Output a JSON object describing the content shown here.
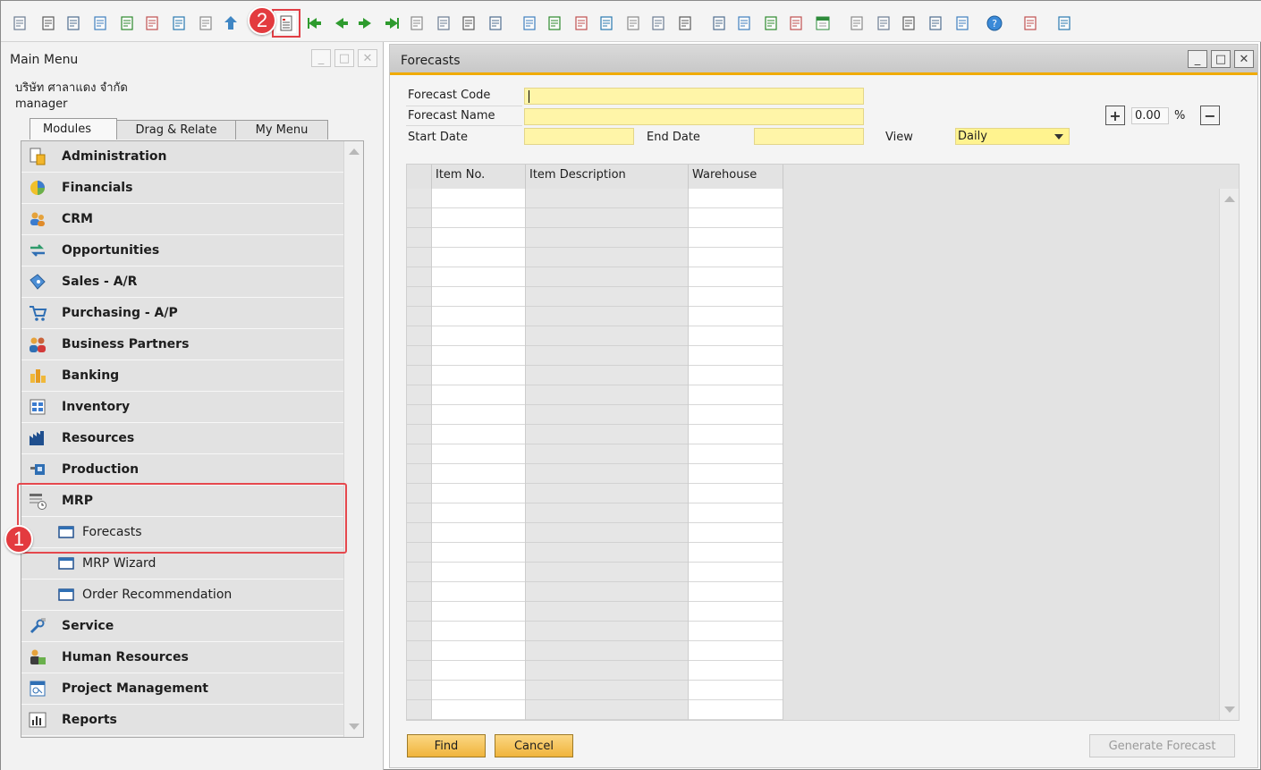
{
  "toolbar": {
    "icons": [
      "print-preview",
      "print",
      "email",
      "sms",
      "export-excel",
      "export-excel-alt",
      "export-word",
      "export-pdf",
      "launch-app",
      "lock-screen",
      "form-settings",
      "first-record",
      "previous-record",
      "next-record",
      "last-record",
      "refresh",
      "filter",
      "sort",
      "base-document",
      "target-document",
      "document-journal",
      "gross-profit",
      "cost-accounting",
      "financial-report",
      "query",
      "edit",
      "create-document",
      "settings",
      "message",
      "message-alt",
      "calendar",
      "mail-alert",
      "spreadsheet",
      "organization",
      "user",
      "web",
      "help",
      "add-on",
      "add-on-2"
    ]
  },
  "badges": {
    "one": "1",
    "two": "2"
  },
  "main_menu": {
    "title": "Main Menu",
    "company": "บริษัท ศาลาแดง จำกัด",
    "user": "manager",
    "tabs": [
      "Modules",
      "Drag & Relate",
      "My Menu"
    ],
    "modules": [
      {
        "label": "Administration",
        "icon": "administration-icon"
      },
      {
        "label": "Financials",
        "icon": "financials-icon"
      },
      {
        "label": "CRM",
        "icon": "crm-icon"
      },
      {
        "label": "Opportunities",
        "icon": "opportunities-icon"
      },
      {
        "label": "Sales - A/R",
        "icon": "sales-icon"
      },
      {
        "label": "Purchasing - A/P",
        "icon": "purchasing-icon"
      },
      {
        "label": "Business Partners",
        "icon": "business-partners-icon"
      },
      {
        "label": "Banking",
        "icon": "banking-icon"
      },
      {
        "label": "Inventory",
        "icon": "inventory-icon"
      },
      {
        "label": "Resources",
        "icon": "resources-icon"
      },
      {
        "label": "Production",
        "icon": "production-icon"
      },
      {
        "label": "MRP",
        "icon": "mrp-icon"
      },
      {
        "label": "Forecasts",
        "icon": "form-icon",
        "sub": true
      },
      {
        "label": "MRP Wizard",
        "icon": "form-icon",
        "sub": true
      },
      {
        "label": "Order Recommendation",
        "icon": "form-icon",
        "sub": true
      },
      {
        "label": "Service",
        "icon": "service-icon"
      },
      {
        "label": "Human Resources",
        "icon": "human-resources-icon"
      },
      {
        "label": "Project Management",
        "icon": "project-management-icon"
      },
      {
        "label": "Reports",
        "icon": "reports-icon"
      }
    ]
  },
  "forecasts": {
    "title": "Forecasts",
    "labels": {
      "code": "Forecast Code",
      "name": "Forecast Name",
      "start": "Start Date",
      "end": "End Date",
      "view": "View"
    },
    "values": {
      "code": "",
      "name": "",
      "start": "",
      "end": "",
      "view": "Daily"
    },
    "percent": {
      "value": "0.00",
      "unit": "%",
      "plus": "+",
      "minus": "−"
    },
    "columns": [
      "Item No.",
      "Item Description",
      "Warehouse"
    ],
    "buttons": {
      "find": "Find",
      "cancel": "Cancel",
      "generate": "Generate Forecast"
    }
  },
  "colors": {
    "highlight": "#e5484d",
    "input_bg": "#fff5a8",
    "title_accent": "#f0ab00"
  }
}
